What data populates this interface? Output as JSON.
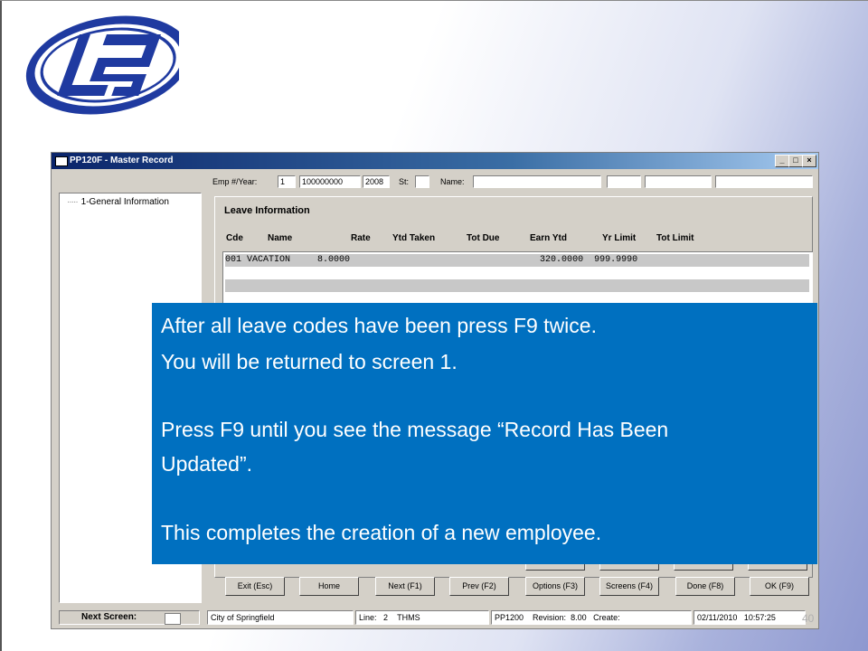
{
  "window": {
    "title": "PP120F - Master Record",
    "min_btn": "_",
    "max_btn": "□",
    "close_btn": "×"
  },
  "tree": {
    "item": "1-General Information"
  },
  "header": {
    "emp_label": "Emp #/Year:",
    "emp_type": "1",
    "emp_number": "100000000",
    "emp_year": "2008",
    "st_label": "St:",
    "st_value": "",
    "name_label": "Name:"
  },
  "leave": {
    "title": "Leave Information",
    "columns": [
      "Cde",
      "Name",
      "Rate",
      "Ytd Taken",
      "Tot Due",
      "Earn Ytd",
      "Yr Limit",
      "Tot Limit"
    ],
    "row1": "001 VACATION     8.0000                                   320.0000  999.9990"
  },
  "buttons": {
    "exit": "Exit (Esc)",
    "home": "Home",
    "next": "Next (F1)",
    "prev": "Prev (F2)",
    "options": "Options (F3)",
    "screens": "Screens (F4)",
    "done": "Done (F8)",
    "ok": "OK (F9)"
  },
  "status": {
    "next_screen_label": "Next Screen:",
    "org": "City of Springfield",
    "line_label": "Line:",
    "line_value": "2",
    "user": "THMS",
    "program": "PP1200",
    "revision_label": "Revision:",
    "revision_value": "8.00",
    "create_label": "Create:",
    "date": "02/11/2010",
    "time": "10:57:25"
  },
  "callout": {
    "line1": "After all leave codes have been press F9 twice.",
    "line2": "You will be returned to screen 1.",
    "line3": "Press F9 until you see the message “Record Has Been",
    "line4": "Updated”.",
    "line5": "This completes the creation of a new employee."
  },
  "page_number": "40",
  "colors": {
    "callout_bg": "#0070c0",
    "titlebar": "#0a246a",
    "logo_blue": "#1f3aa0"
  }
}
